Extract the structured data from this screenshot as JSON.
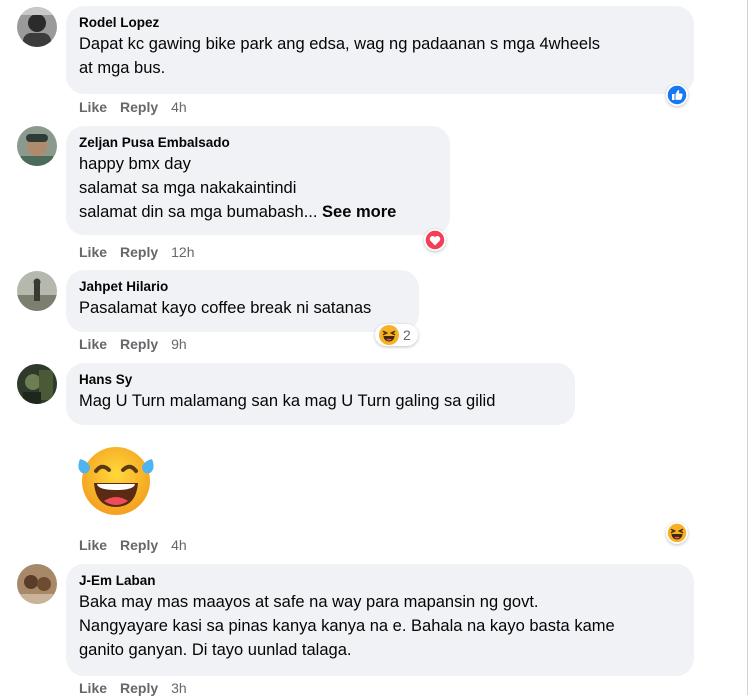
{
  "comments": [
    {
      "author": "Rodel Lopez",
      "text": "Dapat kc gawing bike park ang edsa, wag ng padaanan s mga 4wheels\nat mga bus.",
      "like": "Like",
      "reply": "Reply",
      "time": "4h",
      "reaction": "like-icon"
    },
    {
      "author": "Zeljan Pusa Embalsado",
      "text": "happy bmx day\nsalamat sa mga nakakaintindi\nsalamat din sa mga bumabash... ",
      "see_more": "See more",
      "like": "Like",
      "reply": "Reply",
      "time": "12h",
      "reaction": "love-icon"
    },
    {
      "author": "Jahpet Hilario",
      "text": "Pasalamat kayo coffee break ni satanas",
      "like": "Like",
      "reply": "Reply",
      "time": "9h",
      "reaction": "haha-icon",
      "reaction_count": "2"
    },
    {
      "author": "Hans Sy",
      "text": "Mag U Turn malamang san ka mag U Turn galing sa gilid",
      "attachment": "tears-of-joy-emoji",
      "like": "Like",
      "reply": "Reply",
      "time": "4h",
      "reaction": "haha-icon"
    },
    {
      "author": "J-Em Laban",
      "text": "Baka may mas maayos at safe na way para mapansin ng govt.\nNangyayare kasi sa pinas kanya kanya na e. Bahala na kayo basta kame\nganito ganyan. Di tayo uunlad talaga.",
      "like": "Like",
      "reply": "Reply",
      "time": "3h"
    }
  ],
  "colors": {
    "bubble": "#f0f2f5",
    "meta": "#65676b",
    "like_blue": "#1877f2",
    "love_red": "#f33e58",
    "haha_yellow": "#f7b125"
  }
}
